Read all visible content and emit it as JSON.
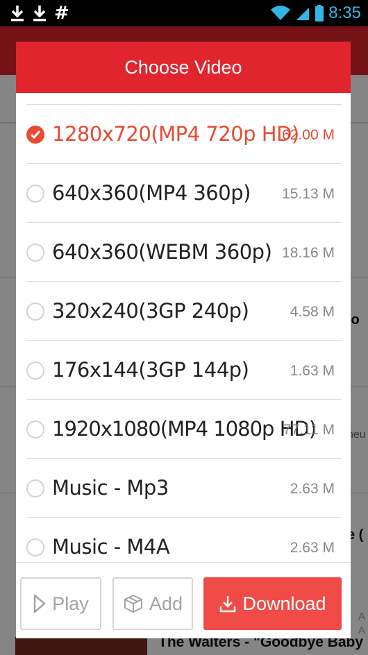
{
  "status_bar": {
    "left_icons": [
      "download-icon",
      "download-icon",
      "hash-icon"
    ],
    "time": "8:35",
    "time_color": "#33b5e5"
  },
  "background_app": {
    "header_color": "#e0252f",
    "right_fragments": [
      "lo",
      "neu",
      "e ("
    ],
    "partial_bottom_title": "The Walters - \"Goodbye Baby",
    "partial_bottom_side": [
      "A",
      "A"
    ]
  },
  "dialog": {
    "title": "Choose Video",
    "header_color": "#e0252f",
    "accent_color": "#e84a33",
    "options": [
      {
        "label": "1280x720(MP4 720p HD)",
        "size": "62.00 M",
        "selected": true
      },
      {
        "label": "640x360(MP4 360p)",
        "size": "15.13 M",
        "selected": false
      },
      {
        "label": "640x360(WEBM 360p)",
        "size": "18.16 M",
        "selected": false
      },
      {
        "label": "320x240(3GP 240p)",
        "size": "4.58 M",
        "selected": false
      },
      {
        "label": "176x144(3GP 144p)",
        "size": "1.63 M",
        "selected": false
      },
      {
        "label": "1920x1080(MP4 1080p HD)",
        "size": "77.11 M",
        "selected": false
      },
      {
        "label": "Music - Mp3",
        "size": "2.63 M",
        "selected": false
      },
      {
        "label": "Music - M4A",
        "size": "2.63 M",
        "selected": false
      }
    ],
    "buttons": {
      "play": "Play",
      "add": "Add",
      "download": "Download",
      "download_color": "#f04b47"
    }
  }
}
